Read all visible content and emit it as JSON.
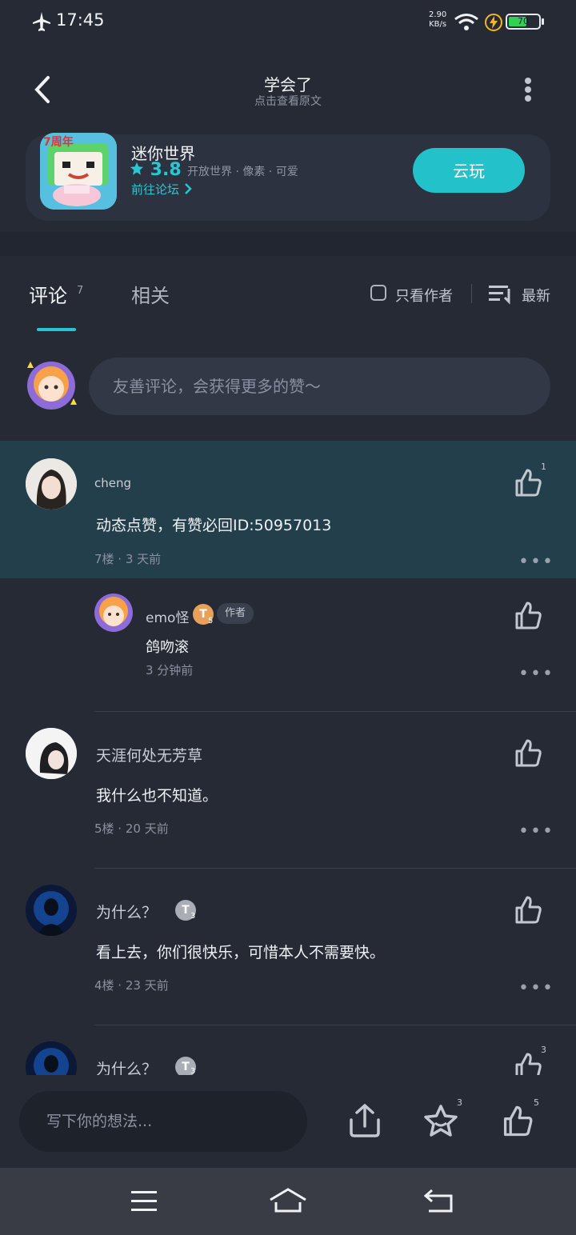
{
  "status_bar": {
    "time": "17:45",
    "net_speed": "2.90",
    "net_unit": "KB/s",
    "battery": "70"
  },
  "header": {
    "title": "学会了",
    "subtitle": "点击查看原文"
  },
  "game": {
    "name": "迷你世界",
    "rating": "3.8",
    "tags": "开放世界 · 像素 · 可爱",
    "forum_link": "前往论坛",
    "play_button": "云玩",
    "icon_banner": "7周年"
  },
  "tabs": {
    "comments": "评论",
    "comments_count": "7",
    "related": "相关",
    "author_only": "只看作者",
    "sort": "最新"
  },
  "comment_box": {
    "placeholder": "友善评论，会获得更多的赞～"
  },
  "comments": [
    {
      "user": "cheng",
      "text": "动态点赞，有赞必回ID:50957013",
      "meta": "7楼 · 3 天前",
      "likes": "1"
    },
    {
      "user": "emo怪",
      "badge": "T",
      "badge_level": "5",
      "author_tag": "作者",
      "text": "鸽吻滚",
      "meta": "3 分钟前"
    },
    {
      "user": "天涯何处无芳草",
      "text": "我什么也不知道。",
      "meta": "5楼 · 20 天前"
    },
    {
      "user": "为什么？",
      "badge": "T",
      "badge_level": "3",
      "text": "看上去，你们很快乐，可惜本人不需要快。",
      "meta": "4楼 · 23 天前"
    },
    {
      "user": "为什么？",
      "badge": "T",
      "badge_level": "3",
      "likes": "3"
    }
  ],
  "bottom_bar": {
    "placeholder": "写下你的想法...",
    "favorites": "3",
    "likes": "5"
  },
  "colors": {
    "accent": "#26c6d2",
    "background": "#262a35",
    "highlight": "#243f4c"
  }
}
